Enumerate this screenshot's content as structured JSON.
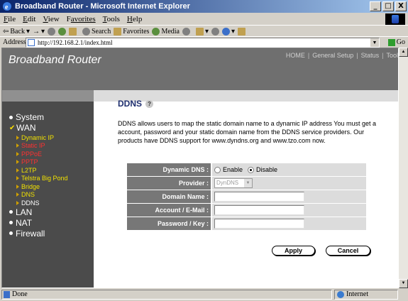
{
  "window": {
    "title": "Broadband Router - Microsoft Internet Explorer",
    "buttons": [
      "_",
      "□",
      "X"
    ]
  },
  "menu": [
    {
      "key": "F",
      "rest": "ile"
    },
    {
      "key": "E",
      "rest": "dit"
    },
    {
      "key": "V",
      "rest": "iew"
    },
    {
      "key": "F",
      "rest": "avorites",
      "full": "Favorites"
    },
    {
      "key": "T",
      "rest": "ools"
    },
    {
      "key": "H",
      "rest": "elp"
    }
  ],
  "toolbar": {
    "back": "Back",
    "search": "Search",
    "favorites": "Favorites",
    "media": "Media"
  },
  "address": {
    "label": "Address",
    "url": "http://192.168.2.1/index.html",
    "go": "Go"
  },
  "page": {
    "brand": "Broadband Router",
    "topnav": [
      "HOME",
      "General Setup",
      "Status",
      "Tool"
    ],
    "sidebar": {
      "system": "System",
      "wan": "WAN",
      "wan_items": [
        {
          "label": "Dynamic IP",
          "color": "yellow"
        },
        {
          "label": "Static IP",
          "color": "red"
        },
        {
          "label": "PPPoE",
          "color": "red"
        },
        {
          "label": "PPTP",
          "color": "red"
        },
        {
          "label": "L2TP",
          "color": "yellow"
        },
        {
          "label": "Telstra Big Pond",
          "color": "yellow"
        },
        {
          "label": "Bridge",
          "color": "yellow"
        },
        {
          "label": "DNS",
          "color": "yellow"
        },
        {
          "label": "DDNS",
          "color": "white"
        }
      ],
      "lan": "LAN",
      "nat": "NAT",
      "firewall": "Firewall"
    },
    "section_title": "DDNS",
    "description": "DDNS allows users to map the static domain name to a dynamic IP address You must get a account, password and your static domain name from the DDNS service providers. Our products have DDNS support for www.dyndns.org and www.tzo.com now.",
    "form": {
      "dynamic_dns_label": "Dynamic DNS :",
      "enable": "Enable",
      "disable": "Disable",
      "dynamic_dns_selected": "Disable",
      "provider_label": "Provider :",
      "provider_value": "DynDNS",
      "domain_label": "Domain Name :",
      "domain_value": "",
      "account_label": "Account / E-Mail :",
      "account_value": "",
      "password_label": "Password / Key :",
      "password_value": ""
    },
    "apply": "Apply",
    "cancel": "Cancel"
  },
  "status": {
    "text": "Done",
    "zone": "Internet"
  }
}
